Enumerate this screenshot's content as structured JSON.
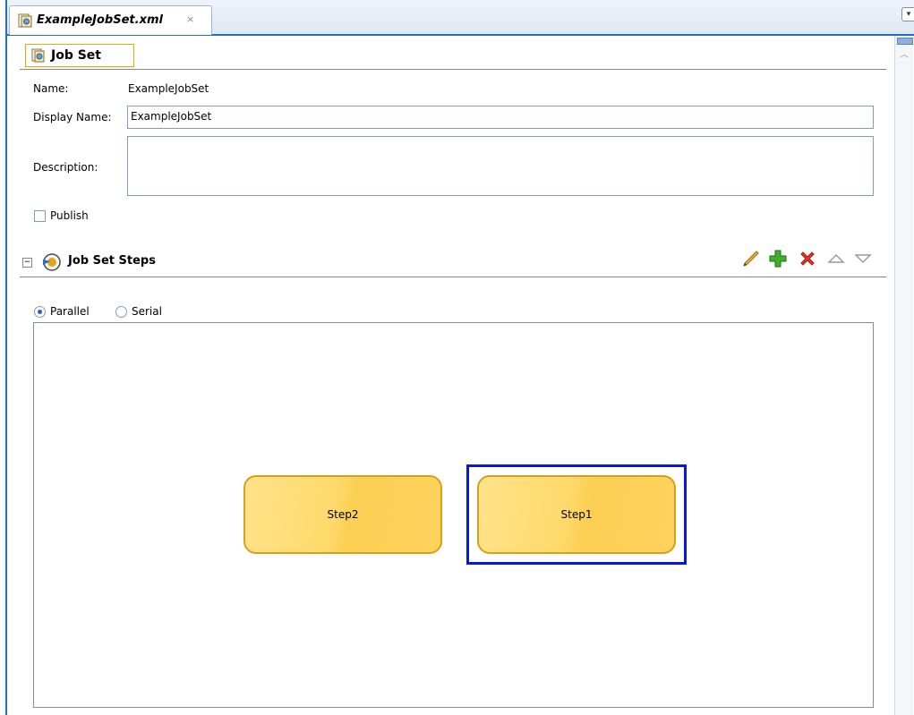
{
  "tab": {
    "title": "ExampleJobSet.xml",
    "close": "×"
  },
  "header": {
    "title": "Job Set"
  },
  "form": {
    "name_label": "Name:",
    "name_value": "ExampleJobSet",
    "display_name_label": "Display Name:",
    "display_name_value": "ExampleJobSet",
    "description_label": "Description:",
    "description_value": "",
    "publish_label": "Publish"
  },
  "steps_section": {
    "title": "Job Set Steps",
    "toolbar": [
      "edit-icon",
      "add-icon",
      "delete-icon",
      "move-up-icon",
      "move-down-icon"
    ],
    "mode_parallel_label": "Parallel",
    "mode_serial_label": "Serial",
    "selected_mode": "Parallel",
    "steps": [
      {
        "label": "Step2"
      },
      {
        "label": "Step1",
        "selected": true
      }
    ]
  },
  "colors": {
    "accent": "#1f6fc7",
    "step_fill": "#ffd96a",
    "step_border": "#d3a21a",
    "selection": "#0b16d6"
  }
}
